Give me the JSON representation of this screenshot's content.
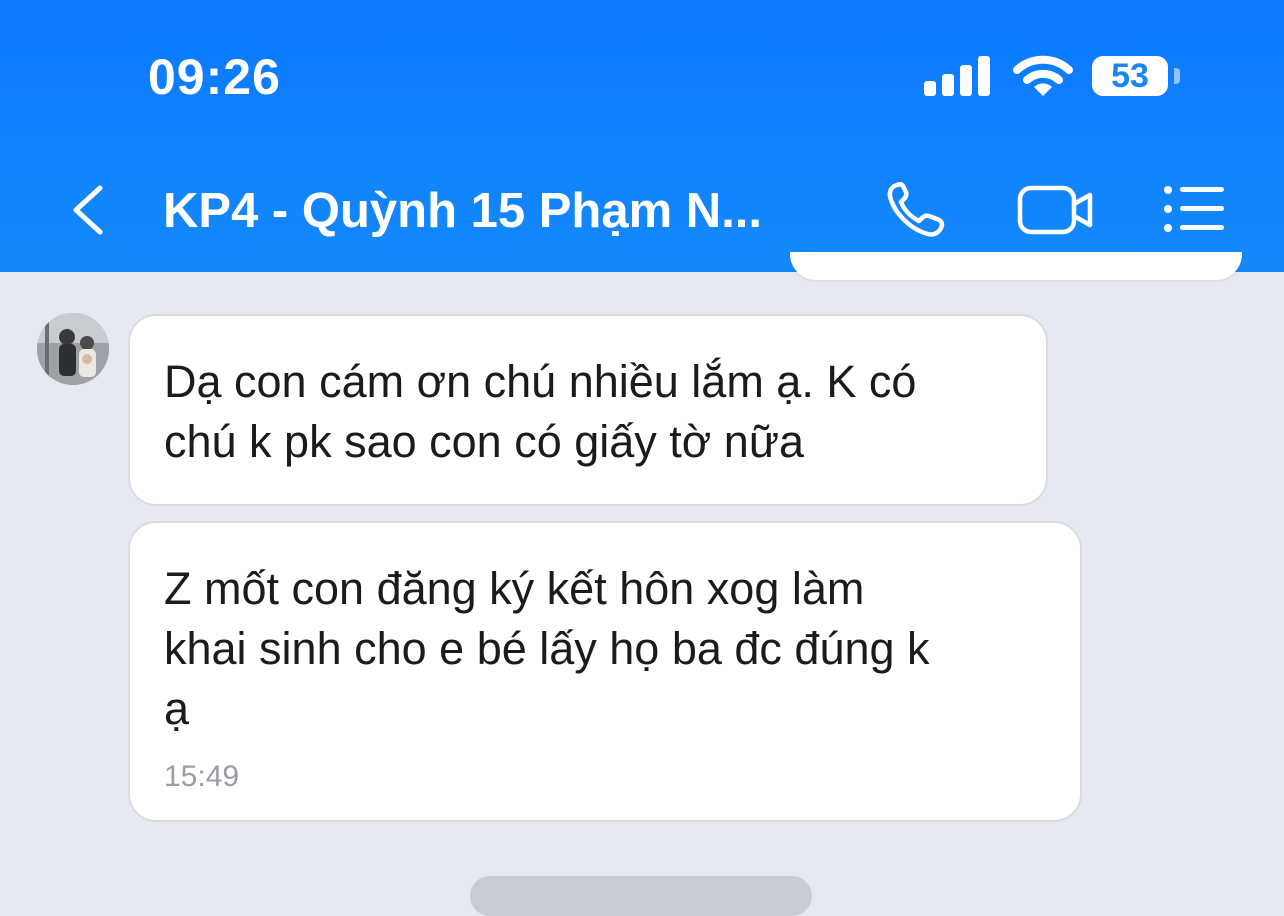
{
  "status_bar": {
    "time": "09:26",
    "battery": "53",
    "icons": [
      "signal-icon",
      "wifi-icon",
      "battery-icon"
    ]
  },
  "header": {
    "title": "KP4 - Quỳnh 15 Phạm N...",
    "background_color": "#0a79ff",
    "icons": [
      "back-icon",
      "phone-icon",
      "video-call-icon",
      "menu-icon"
    ]
  },
  "messages": [
    {
      "lines": [
        "Dạ con cám ơn chú nhiều lắm ạ. K có",
        "chú k pk sao con có giấy tờ nữa"
      ]
    },
    {
      "lines": [
        "Z mốt con đăng ký kết hôn xog làm",
        "khai sinh cho e bé lấy họ ba đc đúng k",
        "ạ"
      ],
      "time": "15:49"
    }
  ]
}
